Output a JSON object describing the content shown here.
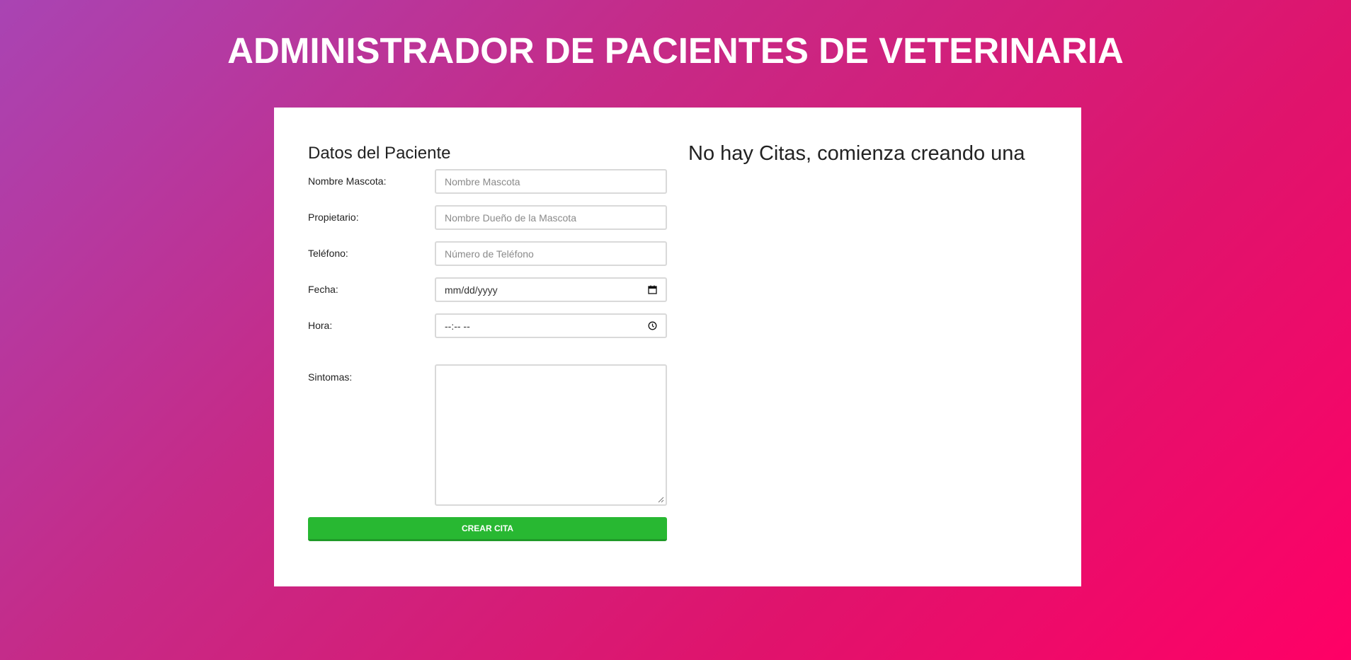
{
  "header": {
    "title": "ADMINISTRADOR DE PACIENTES DE VETERINARIA"
  },
  "form": {
    "heading": "Datos del Paciente",
    "fields": {
      "mascota": {
        "label": "Nombre Mascota:",
        "placeholder": "Nombre Mascota"
      },
      "propietario": {
        "label": "Propietario:",
        "placeholder": "Nombre Dueño de la Mascota"
      },
      "telefono": {
        "label": "Teléfono:",
        "placeholder": "Número de Teléfono"
      },
      "fecha": {
        "label": "Fecha:",
        "value": "mm/dd/yyyy",
        "icon": "calendar-icon"
      },
      "hora": {
        "label": "Hora:",
        "value": "--:-- --",
        "icon": "clock-icon"
      },
      "sintomas": {
        "label": "Sintomas:",
        "value": ""
      }
    },
    "submit_label": "CREAR CITA"
  },
  "citas": {
    "empty_message": "No hay Citas, comienza creando una"
  },
  "colors": {
    "gradient_start": "#a944b3",
    "gradient_end": "#ff0066",
    "button": "#28b832"
  }
}
